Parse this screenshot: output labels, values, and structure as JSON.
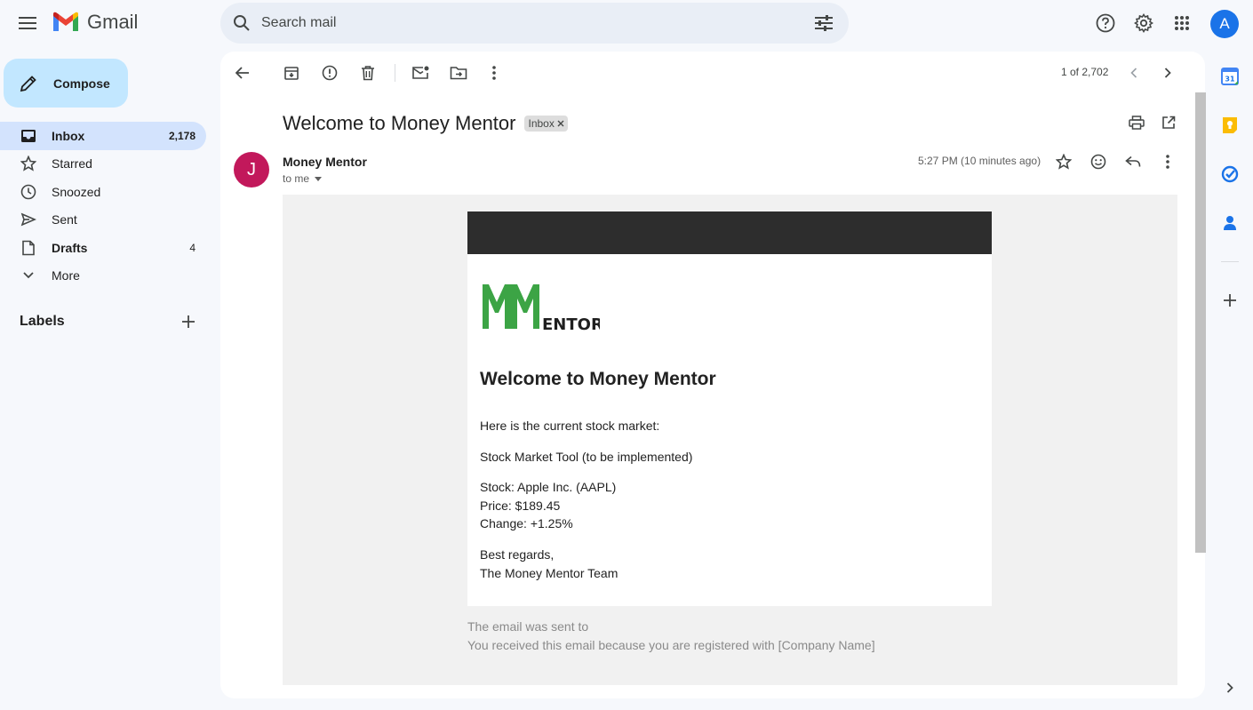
{
  "app": {
    "name": "Gmail"
  },
  "search": {
    "placeholder": "Search mail"
  },
  "compose": {
    "label": "Compose"
  },
  "nav": {
    "items": [
      {
        "label": "Inbox",
        "count": "2,178",
        "icon": "inbox-icon"
      },
      {
        "label": "Starred",
        "count": "",
        "icon": "star-icon"
      },
      {
        "label": "Snoozed",
        "count": "",
        "icon": "clock-icon"
      },
      {
        "label": "Sent",
        "count": "",
        "icon": "send-icon"
      },
      {
        "label": "Drafts",
        "count": "4",
        "icon": "draft-icon"
      },
      {
        "label": "More",
        "count": "",
        "icon": "chevron-down-icon"
      }
    ]
  },
  "labels": {
    "title": "Labels"
  },
  "user": {
    "initial": "A"
  },
  "toolbar": {
    "pager": "1 of 2,702"
  },
  "message": {
    "subject": "Welcome to Money Mentor",
    "chip": "Inbox",
    "sender_name": "Money Mentor",
    "sender_initial": "J",
    "recipient": "to me",
    "time": "5:27 PM (10 minutes ago)"
  },
  "email_body": {
    "logo_text": "ENTOR",
    "title": "Welcome to Money Mentor",
    "intro": "Here is the current stock market:",
    "tool_line": "Stock Market Tool (to be implemented)",
    "stock_line": "Stock: Apple Inc. (AAPL)",
    "price_line": "Price: $189.45",
    "change_line": "Change: +1.25%",
    "signoff": "Best regards,",
    "team": "The Money Mentor Team"
  },
  "footer": {
    "sent_to": "The email was sent to",
    "reason": "You received this email because you are registered with [Company Name]"
  },
  "rail": {
    "calendar_day": "31"
  },
  "colors": {
    "accent": "#1a73e8",
    "compose_bg": "#c2e7ff",
    "active_nav": "#d3e3fd",
    "sender_avatar": "#c2185b",
    "logo_green": "#3ca445"
  }
}
